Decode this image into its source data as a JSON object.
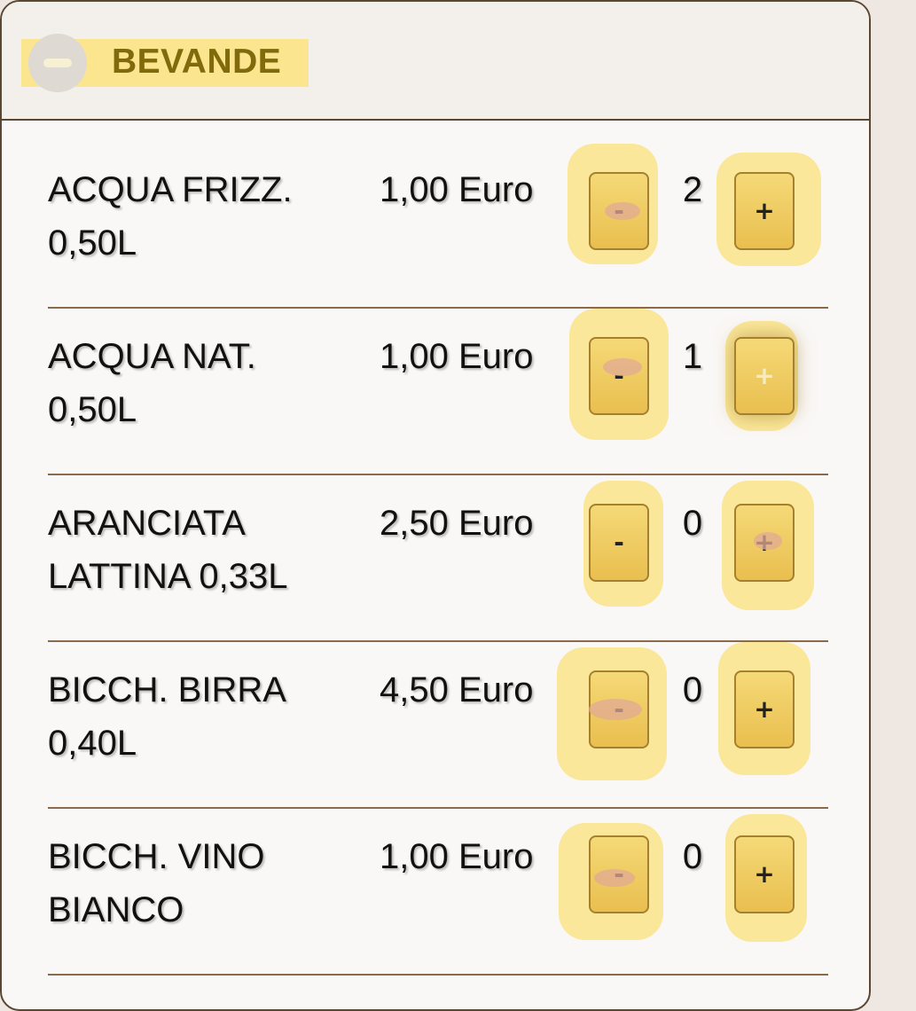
{
  "section": {
    "title": "BEVANDE"
  },
  "items": [
    {
      "name": "ACQUA FRIZZ. 0,50L",
      "price": "1,00 Euro",
      "minus": "-",
      "qty": "2",
      "plus": "+"
    },
    {
      "name": "ACQUA NAT. 0,50L",
      "price": "1,00 Euro",
      "minus": "-",
      "qty": "1",
      "plus": "+"
    },
    {
      "name": "ARANCIATA LATTINA 0,33L",
      "price": "2,50 Euro",
      "minus": "-",
      "qty": "0",
      "plus": "+"
    },
    {
      "name": "BICCH. BIRRA 0,40L",
      "price": "4,50 Euro",
      "minus": "-",
      "qty": "0",
      "plus": "+"
    },
    {
      "name": "BICCH. VINO BIANCO",
      "price": "1,00 Euro",
      "minus": "-",
      "qty": "0",
      "plus": "+"
    }
  ],
  "icons": {
    "collapse": "minus-circle-icon"
  },
  "colors": {
    "accent": "#f0cd62",
    "highlight": "#fbe58e",
    "title": "#806a0c",
    "border": "#5b4632"
  }
}
